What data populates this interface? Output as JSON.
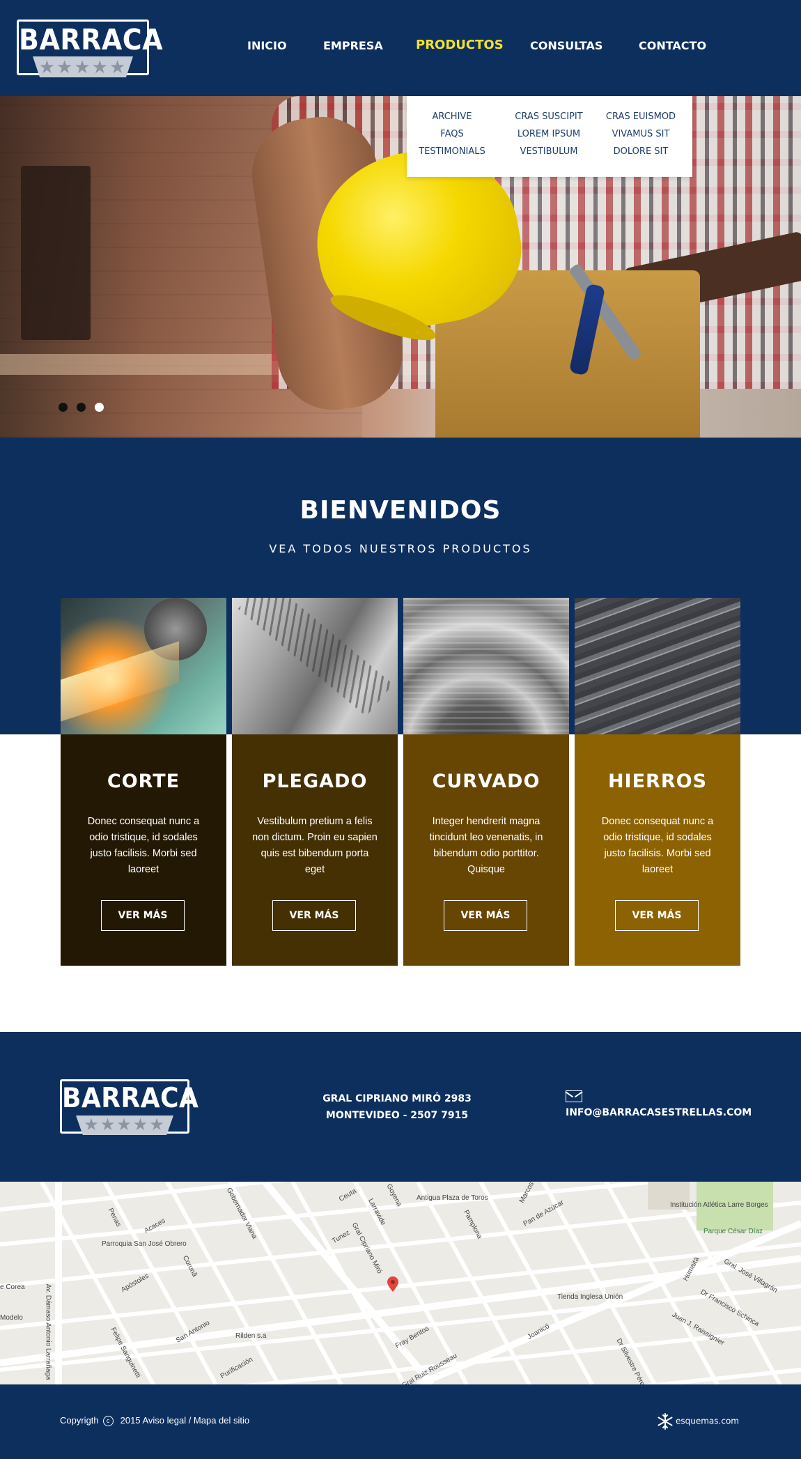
{
  "brand": {
    "logo_text": "BARRACA",
    "logo_stars": "★★★★★"
  },
  "nav": {
    "items": [
      "INICIO",
      "EMPRESA",
      "PRODUCTOS",
      "CONSULTAS",
      "CONTACTO"
    ],
    "active": "PRODUCTOS",
    "active_color": "#f2e22c"
  },
  "dropdown": {
    "columns": [
      [
        "ARCHIVE",
        "FAQS",
        "TESTIMONIALS"
      ],
      [
        "CRAS SUSCIPIT",
        "LOREM IPSUM",
        "VESTIBULUM"
      ],
      [
        "CRAS EUISMOD",
        "VIVAMUS SIT",
        "DOLORE SIT"
      ]
    ]
  },
  "hero": {
    "slides": 3,
    "active_slide": 3
  },
  "welcome": {
    "title": "BIENVENIDOS",
    "subtitle": "VEA TODOS NUESTROS PRODUCTOS"
  },
  "products": [
    {
      "title": "CORTE",
      "text": "Donec consequat nunc a odio tristique, id sodales justo facilisis. Morbi sed laoreet",
      "button": "VER MÁS",
      "color": "#231803"
    },
    {
      "title": "PLEGADO",
      "text": "Vestibulum pretium a felis non dictum. Proin eu sapien quis est bibendum porta eget",
      "button": "VER MÁS",
      "color": "#453004"
    },
    {
      "title": "CURVADO",
      "text": "Integer hendrerit magna tincidunt leo venenatis, in bibendum odio porttitor. Quisque",
      "button": "VER MÁS",
      "color": "#674503"
    },
    {
      "title": "HIERROS",
      "text": "Donec consequat nunc a odio tristique, id sodales justo facilisis. Morbi sed laoreet",
      "button": "VER MÁS",
      "color": "#8c6202"
    }
  ],
  "footer": {
    "address_line1": "GRAL CIPRIANO MIRÓ 2983",
    "address_line2": "MONTEVIDEO - 2507 7915",
    "email": "INFO@BARRACASESTRELLAS.COM",
    "icon": "envelope-icon"
  },
  "map": {
    "labels": [
      "Antigua Plaza de Toros",
      "Institución Atlética Larre Borges",
      "Parque César Díaz",
      "Parroquia San José Obrero",
      "Tienda Inglesa Unión",
      "Rilden s.a",
      "Gral Cipriano Miró",
      "Larravide",
      "Fray Bentos",
      "Pan de Azúcar",
      "Gobernador Viana",
      "Av. Dámaso Antonio Larrañaga",
      "Apóstoles",
      "Corunã",
      "Pamplona",
      "Marcos",
      "Ceuta",
      "Tunez",
      "Juan J. Raissignier",
      "Humaitá",
      "Dr Francisco Schinca",
      "Gral. José Villagrán",
      "Felipe Sanguinetti",
      "San Antonio",
      "Purificación",
      "Joanicó",
      "Dr Silvestre Pérez",
      "Acaces",
      "Penas",
      "Modelo",
      "e Corea",
      "Goyena",
      "Gral Ruiz Rousseau"
    ]
  },
  "bottom": {
    "copyright_word": "Copyrigth",
    "copyright_symbol": "c",
    "copyright_rest": "2015  Aviso legal / Mapa del sitio",
    "credit": "esquemas.com"
  },
  "colors": {
    "navy": "#0d2f5e",
    "white": "#ffffff"
  }
}
